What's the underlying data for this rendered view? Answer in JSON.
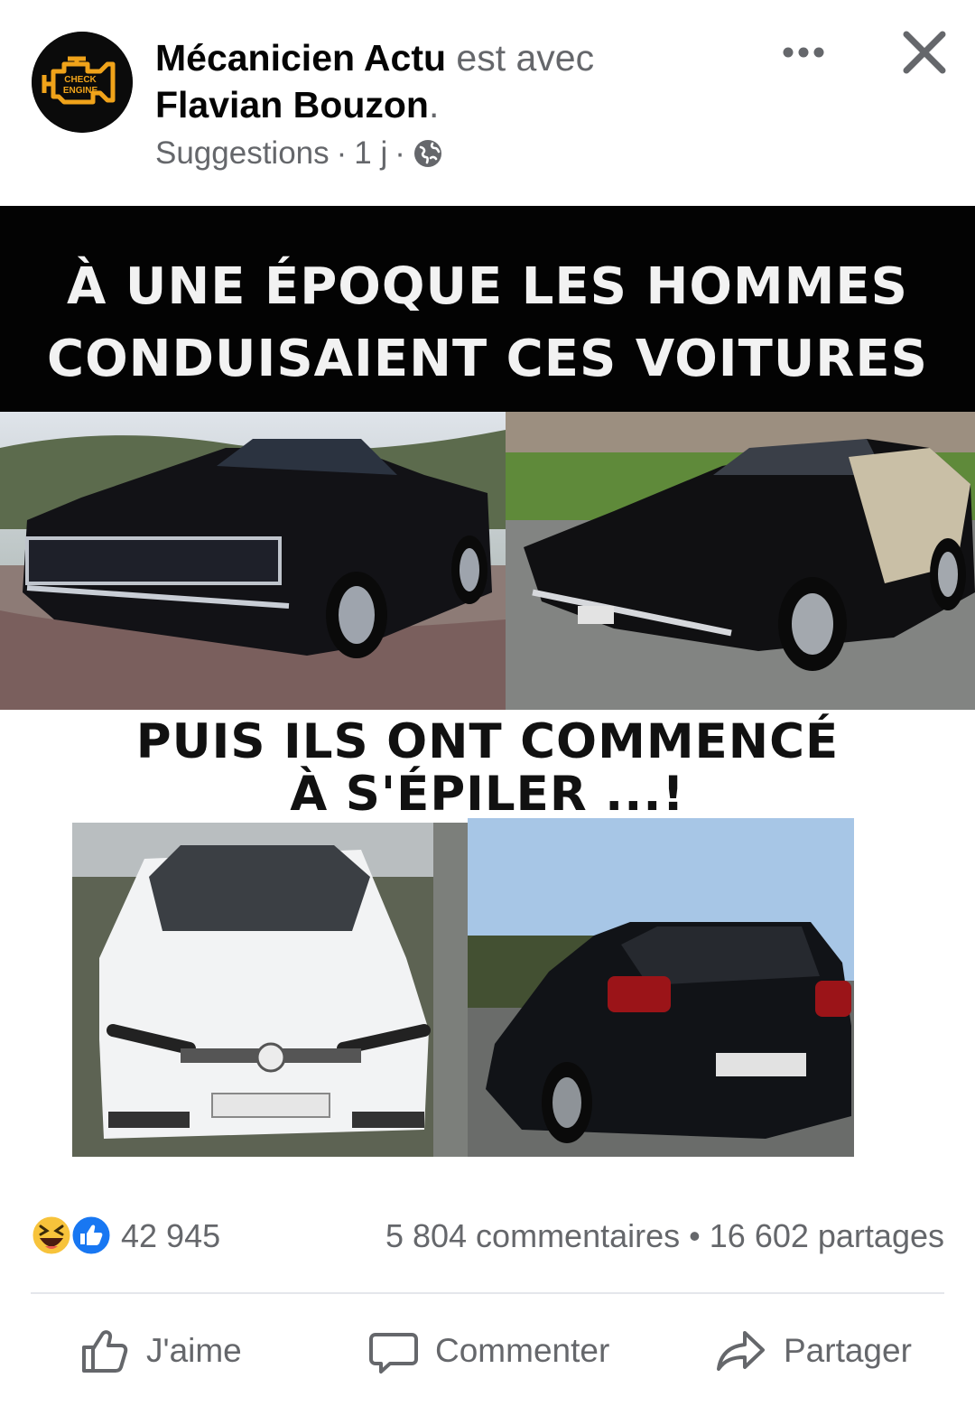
{
  "post": {
    "page_name": "Mécanicien Actu",
    "with_text": "est avec",
    "tagged": "Flavian Bouzon",
    "period": ".",
    "meta_source": "Suggestions",
    "meta_sep1": "·",
    "meta_time": "1 j",
    "meta_sep2": "·",
    "icons": {
      "audience": "globe-icon",
      "more": "more-icon",
      "close": "close-icon"
    },
    "avatar": {
      "logo_line1": "CHECK",
      "logo_line2": "ENGINE",
      "logo_color": "#f0a31a"
    }
  },
  "meme": {
    "top_line1": "À UNE ÉPOQUE LES HOMMES",
    "top_line2": "CONDUISAIENT CES VOITURES",
    "mid_line1": "PUIS ILS ONT COMMENCÉ",
    "mid_line2": "À S'ÉPILER ...!"
  },
  "stats": {
    "reaction_icons": [
      "haha-icon",
      "like-icon"
    ],
    "reactions": "42 945",
    "comments": "5 804 commentaires",
    "dot": "•",
    "shares": "16 602 partages"
  },
  "actions": {
    "like": "J'aime",
    "comment": "Commenter",
    "share": "Partager"
  },
  "colors": {
    "muted": "#65676b",
    "like_blue": "#1877f2",
    "haha_yellow": "#f7c33b"
  }
}
